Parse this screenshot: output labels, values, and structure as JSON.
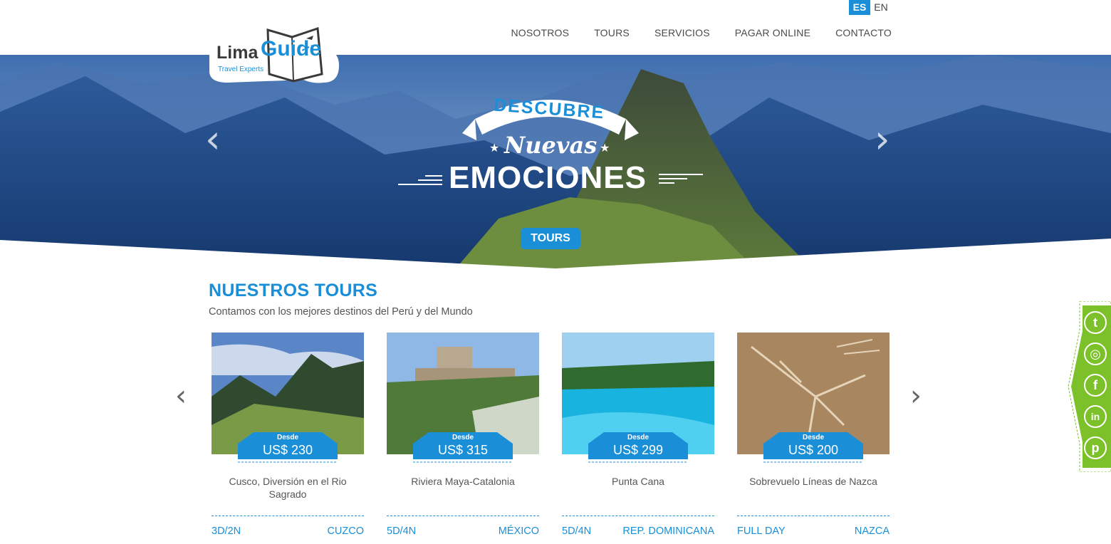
{
  "lang": {
    "active": "ES",
    "inactive": "EN"
  },
  "brand": {
    "name_part1": "Lima",
    "name_part2": "Guide",
    "tagline": "Travel Experts"
  },
  "nav": {
    "items": [
      "NOSOTROS",
      "TOURS",
      "SERVICIOS",
      "PAGAR ONLINE",
      "CONTACTO"
    ]
  },
  "hero": {
    "line1": "DESCUBRE",
    "line2": "Nuevas",
    "line3": "EMOCIONES",
    "button": "TOURS",
    "prev": "‹",
    "next": "›"
  },
  "section": {
    "title": "NUESTROS TOURS",
    "subtitle": "Contamos con los mejores destinos del Perú y del Mundo",
    "prev": "‹",
    "next": "›"
  },
  "tours": [
    {
      "desde": "Desde",
      "price": "US$ 230",
      "name": "Cusco, Diversión en el Rio Sagrado",
      "days": "3D/2N",
      "place": "CUZCO"
    },
    {
      "desde": "Desde",
      "price": "US$ 315",
      "name": "Riviera Maya-Catalonia",
      "days": "5D/4N",
      "place": "MÉXICO"
    },
    {
      "desde": "Desde",
      "price": "US$ 299",
      "name": "Punta Cana",
      "days": "5D/4N",
      "place": "REP. DOMINICANA"
    },
    {
      "desde": "Desde",
      "price": "US$ 200",
      "name": "Sobrevuelo Líneas de Nazca",
      "days": "FULL DAY",
      "place": "NAZCA"
    }
  ],
  "social": {
    "icons": [
      "twitter-icon",
      "instagram-icon",
      "facebook-icon",
      "linkedin-icon",
      "pinterest-icon"
    ],
    "glyphs": [
      "t",
      "◎",
      "f",
      "in",
      "p"
    ]
  },
  "colors": {
    "accent": "#1a8fd8",
    "social_green": "#7cc12a"
  }
}
